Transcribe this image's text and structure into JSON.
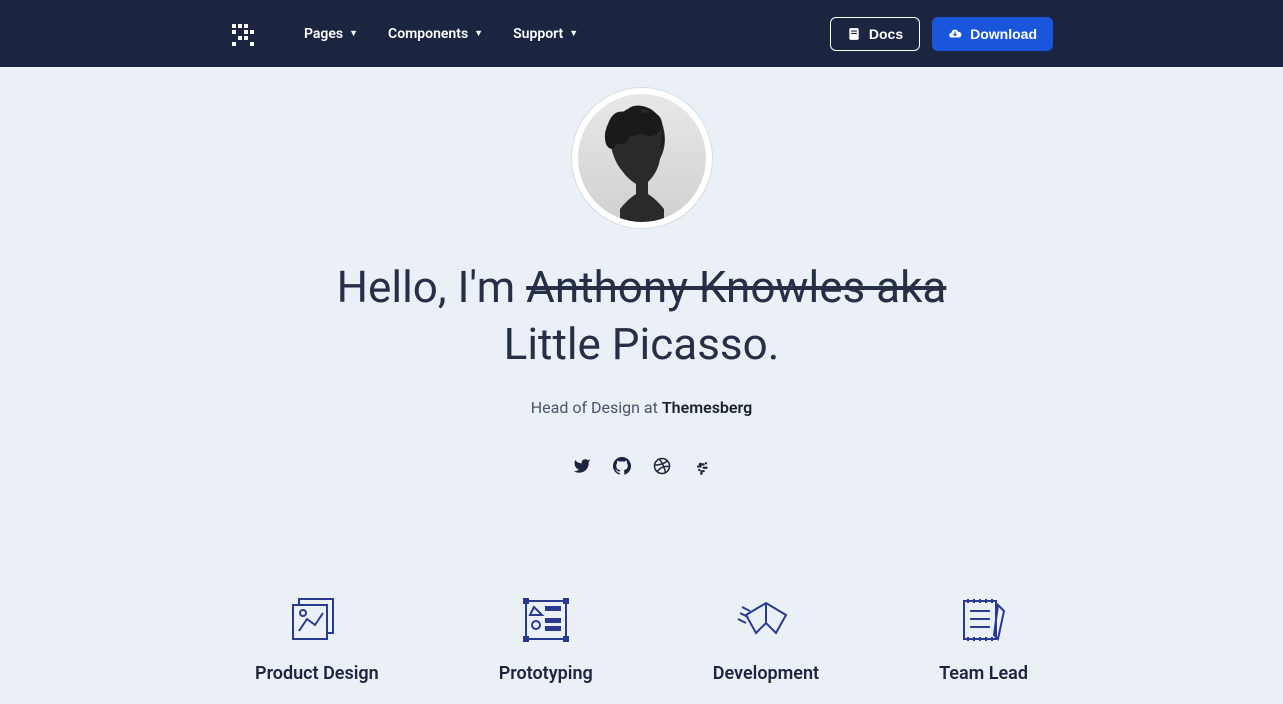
{
  "nav": {
    "items": [
      {
        "label": "Pages"
      },
      {
        "label": "Components"
      },
      {
        "label": "Support"
      }
    ],
    "docs": "Docs",
    "download": "Download"
  },
  "hero": {
    "greeting": "Hello, I'm ",
    "strike_name": "Anthony Knowles aka",
    "display_name": " Little Picasso.",
    "subtitle_prefix": "Head of Design at ",
    "subtitle_company": "Themesberg"
  },
  "socials": [
    {
      "name": "twitter"
    },
    {
      "name": "github"
    },
    {
      "name": "dribbble"
    },
    {
      "name": "slack"
    }
  ],
  "skills": [
    {
      "label": "Product Design"
    },
    {
      "label": "Prototyping"
    },
    {
      "label": "Development"
    },
    {
      "label": "Team Lead"
    }
  ]
}
